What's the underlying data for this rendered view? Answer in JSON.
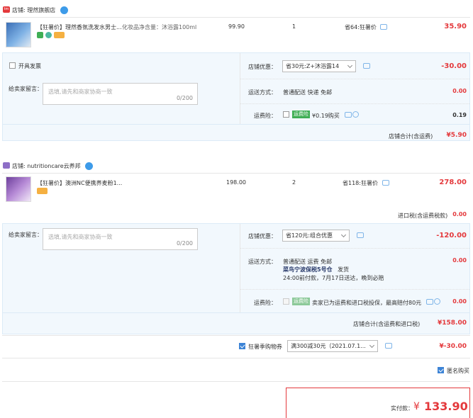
{
  "shop1": {
    "name": "店铺: 理然旗舰店",
    "item": {
      "title": "【狂暑价】理然香氛洗发水男士...",
      "spec": "化妆品净含量：沐浴露100ml",
      "price": "99.90",
      "qty": "1",
      "save": "省64:狂暑价",
      "total": "35.90"
    },
    "invoice": "开具发票",
    "message_label": "给卖家留言：",
    "message_placeholder": "选填,请先和商家协商一致",
    "message_count": "0/200",
    "discount_label": "店铺优惠：",
    "discount_select": "省30元:Z+沐浴露14",
    "discount_value": "-30.00",
    "delivery_label": "运送方式：",
    "delivery_text": "普通配送 快递 免邮",
    "delivery_value": "0.00",
    "insurance_label": "运费险：",
    "insurance_tag": "运费险",
    "insurance_text": "¥0.19购买",
    "insurance_value": "0.19",
    "subtotal_label": "店铺合计(含运费)",
    "subtotal_value": "¥5.90"
  },
  "shop2": {
    "name": "店铺: nutritioncare云养邦",
    "item": {
      "title": "【狂暑价】澳洲NC便携荞麦粉1...",
      "price": "198.00",
      "qty": "2",
      "save": "省118:狂暑价",
      "total": "278.00"
    },
    "import_tax_label": "进口税(含运费税款)",
    "import_tax_value": "0.00",
    "message_label": "给卖家留言：",
    "message_placeholder": "选填,请先和商家协商一致",
    "message_count": "0/200",
    "discount_label": "店铺优惠：",
    "discount_select": "省120元:组合优惠",
    "discount_value": "-120.00",
    "delivery_label": "运送方式：",
    "delivery_line1": "普通配送 运费 免邮",
    "delivery_line2": "菜鸟宁波保税5号仓",
    "delivery_ship": "发货",
    "delivery_line3": "24:00前付款，7月17日送达，晚到必赔",
    "delivery_value": "0.00",
    "insurance_label": "运费险：",
    "insurance_tag": "运费险",
    "insurance_text": "卖家已为运费和进口税投保，最高赔付80元",
    "insurance_value": "0.00",
    "subtotal_label": "店铺合计(含运费和进口税)",
    "subtotal_value": "¥158.00"
  },
  "coupon": {
    "label": "狂暑季购物券",
    "select": "满300减30元（2021.07.1...",
    "value": "¥-30.00"
  },
  "anonymous": "匿名购买",
  "pay": {
    "label": "实付款：",
    "currency": "¥",
    "amount": "133.90"
  },
  "colors": {
    "price_red": "#e4393c",
    "bar_bg": "#f2f8fd",
    "accent_blue": "#3d84d6",
    "insurance_green": "#3fae54"
  }
}
